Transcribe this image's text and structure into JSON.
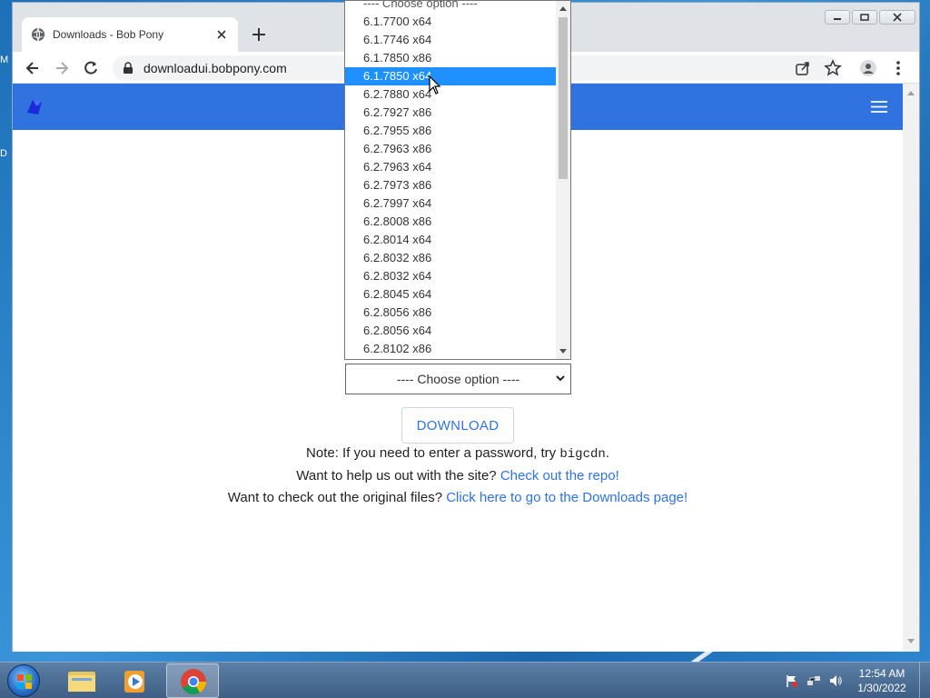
{
  "browser": {
    "tab_title": "Downloads - Bob Pony",
    "url": "downloadui.bobpony.com"
  },
  "desktop": {
    "left_fragments": [
      "M",
      "D"
    ]
  },
  "page": {
    "select_value": "---- Choose option ----",
    "download_label": "DOWNLOAD",
    "note_prefix": "Note: If you need to enter a password, try ",
    "note_code": "bigcdn",
    "note_suffix": ".",
    "help_prefix": "Want to help us out with the site? ",
    "help_link": "Check out the repo!",
    "original_prefix": "Want to check out the original files? ",
    "original_link": "Click here to go to the Downloads page!"
  },
  "dropdown": {
    "options": [
      "---- Choose option ----",
      "6.1.7700 x64",
      "6.1.7746 x64",
      "6.1.7850 x86",
      "6.1.7850 x64",
      "6.2.7880 x64",
      "6.2.7927 x86",
      "6.2.7955 x86",
      "6.2.7963 x86",
      "6.2.7963 x64",
      "6.2.7973 x86",
      "6.2.7997 x64",
      "6.2.8008 x86",
      "6.2.8014 x64",
      "6.2.8032 x86",
      "6.2.8032 x64",
      "6.2.8045 x64",
      "6.2.8056 x86",
      "6.2.8056 x64",
      "6.2.8102 x86"
    ],
    "highlighted": "6.1.7850 x64"
  },
  "taskbar": {
    "apps": [
      "explorer",
      "media-player",
      "chrome"
    ],
    "time": "12:54 AM",
    "date": "1/30/2022"
  },
  "colors": {
    "navbar": "#2f72e0",
    "link": "#2f72e0",
    "highlight": "#1e90ff"
  }
}
